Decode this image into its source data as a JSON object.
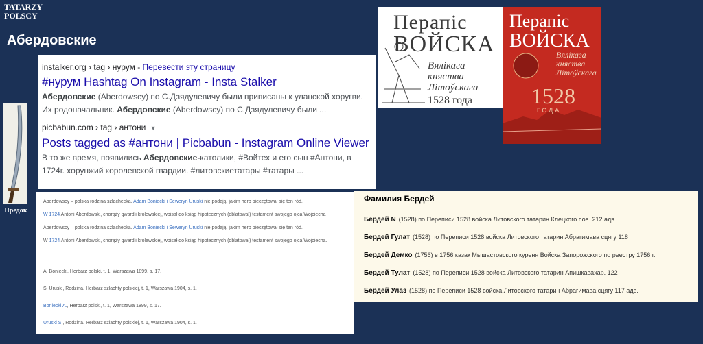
{
  "site": {
    "line1": "TATARZY",
    "line2": "POLSCY"
  },
  "page_title": "Абердовские",
  "ancestor_label": "Предок",
  "results": [
    {
      "crumb": "instalker.org › tag › нурум",
      "translate": "Перевести эту страницу",
      "title": "#нурум Hashtag On Instagram - Insta Stalker",
      "s1_b": "Абердовские",
      "s1": " (Aberdowscy) по С.Дзядулевичу были приписаны к уланской хоругви. Их родоначальник. ",
      "s2_b": "Абердовские",
      "s2": " (Aberdowscy) по С.Дзядулевичу были ..."
    },
    {
      "crumb": "picbabun.com › tag › антони",
      "title": "Posts tagged as #антони | Picbabun - Instagram Online Viewer",
      "s1": "В то же время, появились ",
      "s1_b": "Абердовские",
      "s2": "-католики, #Войтех и его сын #Антони, в 1724г. хорунжий королевской гвардии. #литовскиетатары #татары ..."
    }
  ],
  "book1": {
    "line1": "Перапіс",
    "line2": "ВОЙСКА",
    "line3": "Вялікага",
    "line4": "княства",
    "line5": "Літоўскага",
    "line6": "1528 года"
  },
  "book2": {
    "line1": "Перапіс",
    "line2": "ВОЙСКА",
    "line3": "Вялікага",
    "line4": "княства",
    "line5": "Літоўскага",
    "line6": "1528",
    "line7": "ГОДА"
  },
  "doc": {
    "p1a": "Aberdowscy – polska rodzina szlachecka. ",
    "p1_link": "Adam Boniecki i Seweryn Uruski",
    "p1b": " nie podają, jakim herb pieczętował się ten ród.",
    "p2_link": "W 1724",
    "p2": " Antoni Aberdowski, chorąży gwardii królewskiej, wpisał do ksiąg hipotecznych (oblatował) testament swojego ojca Wojciecha",
    "p3a": "Aberdowscy – polska rodzina szlachecka. ",
    "p3_link": "Adam Boniecki i Seweryn Uruski",
    "p3b": " nie podają, jakim herb pieczętował się ten ród.",
    "p4a": "W ",
    "p4_link": "1724",
    "p4": " Antoni Aberdowski, chorąży gwardii królewskiej, wpisał do ksiąg hipotecznych (oblatował) testament swojego ojca Wojciecha.",
    "r1": "A. Boniecki, Herbarz polski, t. 1, Warszawa 1899, s. 17.",
    "r2": "S. Uruski, Rodzina. Herbarz szlachty polskiej, t. 1, Warszawa 1904, s. 1.",
    "r3_link": "Boniecki A.",
    "r3": ", Herbarz polski, t. 1, Warszawa 1899, s. 17.",
    "r4_link": "Uruski S.",
    "r4": ", Rodzina. Herbarz szlachty polskiej, t. 1, Warszawa 1904, s. 1."
  },
  "surname": {
    "title": "Фамилия Бердей",
    "rows": [
      {
        "name": "Бердей N",
        "text": "(1528) по Переписи 1528 войска Литовского татарин Клецкого пов. 212 адв."
      },
      {
        "name": "Бердей Гулат",
        "text": "(1528) по Переписи 1528 войска Литовского татарин Абрагимава сцягу 118"
      },
      {
        "name": "Бердей Демко",
        "text": "(1756) в 1756 казак Мышастовского куреня Войска Запорожского по реестру 1756 г."
      },
      {
        "name": "Бердей Тулат",
        "text": "(1528) по Переписи 1528 войска Литовского татарин Апишкавахар. 122"
      },
      {
        "name": "Бердей Улаз",
        "text": "(1528) по Переписи 1528 войска Литовского татарин Абрагимава сцягу 117 адв."
      }
    ]
  }
}
